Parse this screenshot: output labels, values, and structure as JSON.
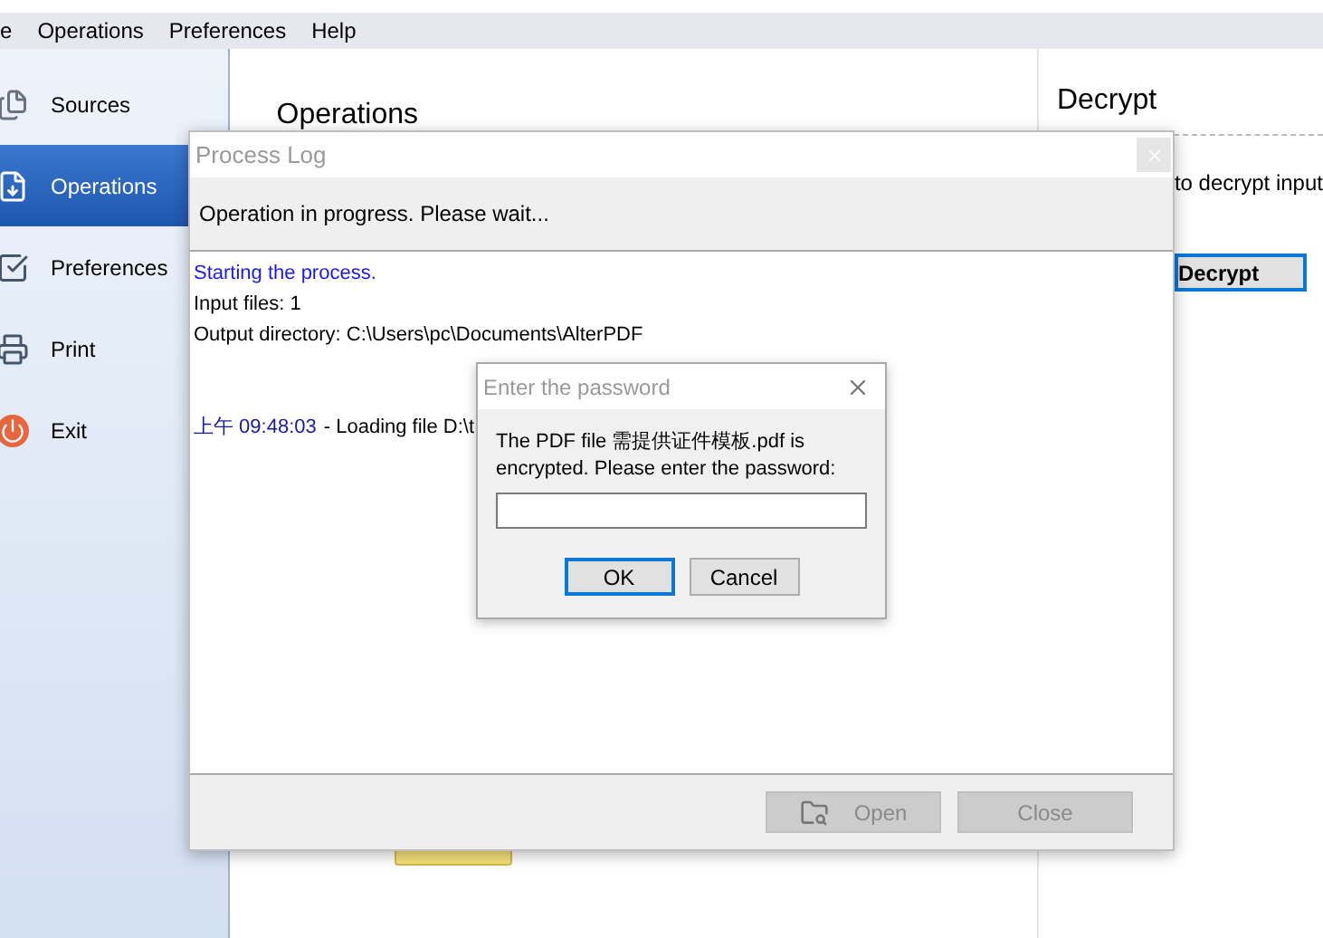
{
  "menu": [
    {
      "label": "e"
    },
    {
      "label": "Operations"
    },
    {
      "label": "Preferences"
    },
    {
      "label": "Help"
    }
  ],
  "sidebar": {
    "items": [
      {
        "label": "Sources",
        "selected": false
      },
      {
        "label": "Operations",
        "selected": true
      },
      {
        "label": "Preferences",
        "selected": false
      },
      {
        "label": "Print",
        "selected": false
      },
      {
        "label": "Exit",
        "selected": false
      }
    ]
  },
  "main": {
    "heading": "Operations"
  },
  "right_panel": {
    "heading": "Decrypt",
    "description": "to decrypt input",
    "button": "Decrypt"
  },
  "process_log": {
    "title": "Process Log",
    "status": "Operation in progress. Please wait...",
    "lines": [
      {
        "kind": "info",
        "text": "Starting the process."
      },
      {
        "kind": "plain",
        "text": "Input files: 1"
      },
      {
        "kind": "plain",
        "text": "Output directory: C:\\Users\\pc\\Documents\\AlterPDF"
      },
      {
        "kind": "timed",
        "time": "上午 09:48:03",
        "text": "- Loading file D:\\t"
      }
    ],
    "buttons": [
      {
        "label": "Open",
        "disabled": true
      },
      {
        "label": "Close",
        "disabled": true
      }
    ]
  },
  "password_dialog": {
    "title": "Enter the password",
    "message": "The PDF file 需提供证件模板.pdf is encrypted. Please enter the password:",
    "buttons": [
      {
        "label": "OK",
        "selected": true
      },
      {
        "label": "Cancel",
        "selected": false
      }
    ]
  }
}
